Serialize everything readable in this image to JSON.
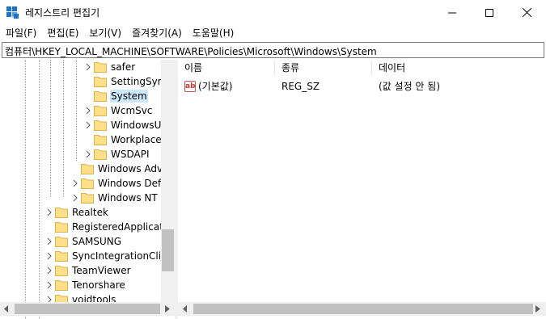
{
  "window": {
    "title": "레지스트리 편집기",
    "icon": "regedit-icon"
  },
  "menu": [
    {
      "label": "파일(F)"
    },
    {
      "label": "편집(E)"
    },
    {
      "label": "보기(V)"
    },
    {
      "label": "즐겨찾기(A)"
    },
    {
      "label": "도움말(H)"
    }
  ],
  "address": {
    "path": "컴퓨터\\HKEY_LOCAL_MACHINE\\SOFTWARE\\Policies\\Microsoft\\Windows\\System"
  },
  "tree": {
    "items": [
      {
        "label": "safer",
        "expandable": true,
        "selected": false
      },
      {
        "label": "SettingSync",
        "expandable": false,
        "selected": false
      },
      {
        "label": "System",
        "expandable": false,
        "selected": true
      },
      {
        "label": "WcmSvc",
        "expandable": true,
        "selected": false
      },
      {
        "label": "WindowsUp",
        "expandable": true,
        "selected": false
      },
      {
        "label": "WorkplaceJ",
        "expandable": false,
        "selected": false
      },
      {
        "label": "WSDAPI",
        "expandable": true,
        "selected": false
      },
      {
        "label": "Windows Adva",
        "expandable": false,
        "selected": false
      },
      {
        "label": "Windows Defe",
        "expandable": true,
        "selected": false
      },
      {
        "label": "Windows NT",
        "expandable": true,
        "selected": false
      },
      {
        "label": "Realtek",
        "expandable": true,
        "selected": false
      },
      {
        "label": "RegisteredApplication",
        "expandable": false,
        "selected": false
      },
      {
        "label": "SAMSUNG",
        "expandable": true,
        "selected": false
      },
      {
        "label": "SyncIntegrationClier",
        "expandable": true,
        "selected": false
      },
      {
        "label": "TeamViewer",
        "expandable": true,
        "selected": false
      },
      {
        "label": "Tenorshare",
        "expandable": true,
        "selected": false
      },
      {
        "label": "voidtools",
        "expandable": true,
        "selected": false
      }
    ]
  },
  "list": {
    "columns": {
      "name": "이름",
      "type": "종류",
      "data": "데이터"
    },
    "rows": [
      {
        "name": "(기본값)",
        "type": "REG_SZ",
        "data": "(값 설정 안 됨)",
        "icon": "ab-string-icon"
      }
    ]
  },
  "colors": {
    "selection": "#cce8ff",
    "folder": "#ffe08a",
    "scrollbar_track": "#f0f0f0",
    "scrollbar_thumb": "#c1c1c1"
  }
}
